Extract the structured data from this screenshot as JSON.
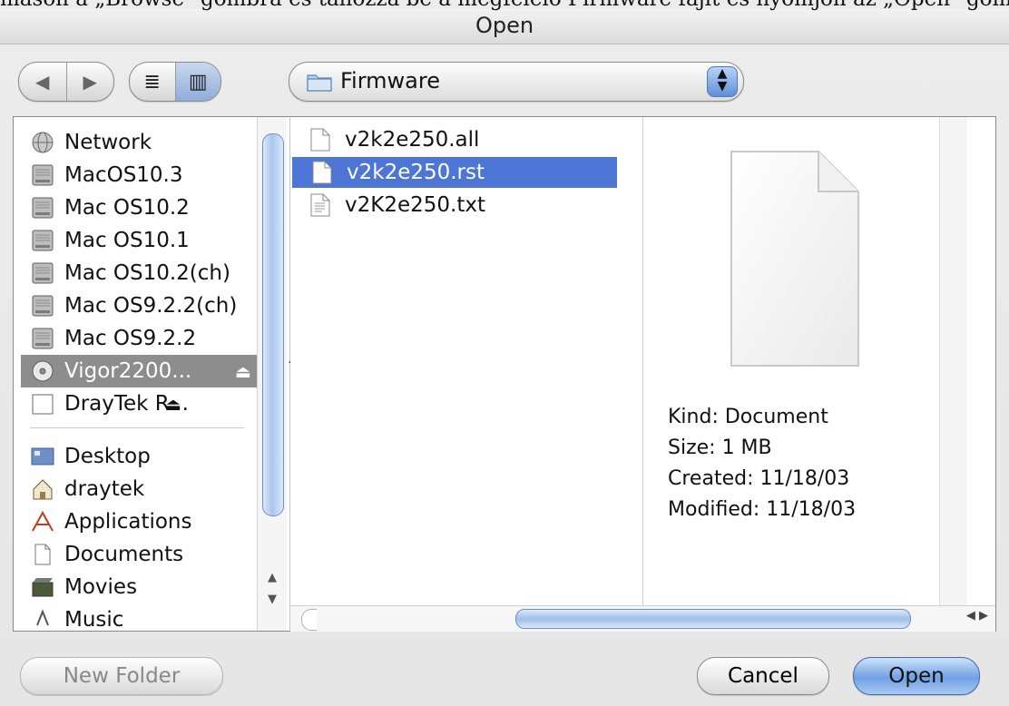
{
  "caption": "mason a „Browse\" gombra és tallózza be a megfelelő Firmware fájlt és nyomjon az „Open\" gombra.",
  "dialog": {
    "title": "Open"
  },
  "toolbar": {
    "nav_back": "◀",
    "nav_forward": "▶",
    "view_list": "≣",
    "view_columns": "▥",
    "location": "Firmware"
  },
  "sidebar": {
    "volumes": [
      {
        "label": "Network",
        "icon": "network-icon"
      },
      {
        "label": "MacOS10.3",
        "icon": "hard-disk-icon"
      },
      {
        "label": "Mac OS10.2",
        "icon": "hard-disk-icon"
      },
      {
        "label": "Mac OS10.1",
        "icon": "hard-disk-icon"
      },
      {
        "label": "Mac OS10.2(ch)",
        "icon": "hard-disk-icon"
      },
      {
        "label": "Mac OS9.2.2(ch)",
        "icon": "hard-disk-icon"
      },
      {
        "label": "Mac OS9.2.2",
        "icon": "hard-disk-icon"
      },
      {
        "label": "Vigor2200...",
        "icon": "cd-icon",
        "eject": "⏏"
      },
      {
        "label": "DrayTek R...",
        "icon": "drive-icon",
        "eject": "⏏"
      }
    ],
    "places": [
      {
        "label": "Desktop",
        "icon": "desktop-icon"
      },
      {
        "label": "draytek",
        "icon": "home-icon"
      },
      {
        "label": "Applications",
        "icon": "applications-icon"
      },
      {
        "label": "Documents",
        "icon": "documents-icon"
      },
      {
        "label": "Movies",
        "icon": "movies-icon"
      },
      {
        "label": "Music",
        "icon": "music-icon"
      }
    ],
    "selected": "Vigor2200..."
  },
  "files": [
    {
      "name": "v2k2e250.all",
      "icon": "document-icon"
    },
    {
      "name": "v2k2e250.rst",
      "icon": "document-icon"
    },
    {
      "name": "v2K2e250.txt",
      "icon": "text-document-icon"
    }
  ],
  "selected_file": "v2k2e250.rst",
  "preview": {
    "kind": "Kind: Document",
    "size": "Size: 1 MB",
    "created": "Created: 11/18/03",
    "modified": "Modified: 11/18/03"
  },
  "buttons": {
    "new_folder": "New Folder",
    "cancel": "Cancel",
    "open": "Open"
  },
  "colors": {
    "selection": "#4c75d6",
    "sidebar_selection": "#8d8d8d",
    "aqua_blue": "#6fa1e5"
  }
}
